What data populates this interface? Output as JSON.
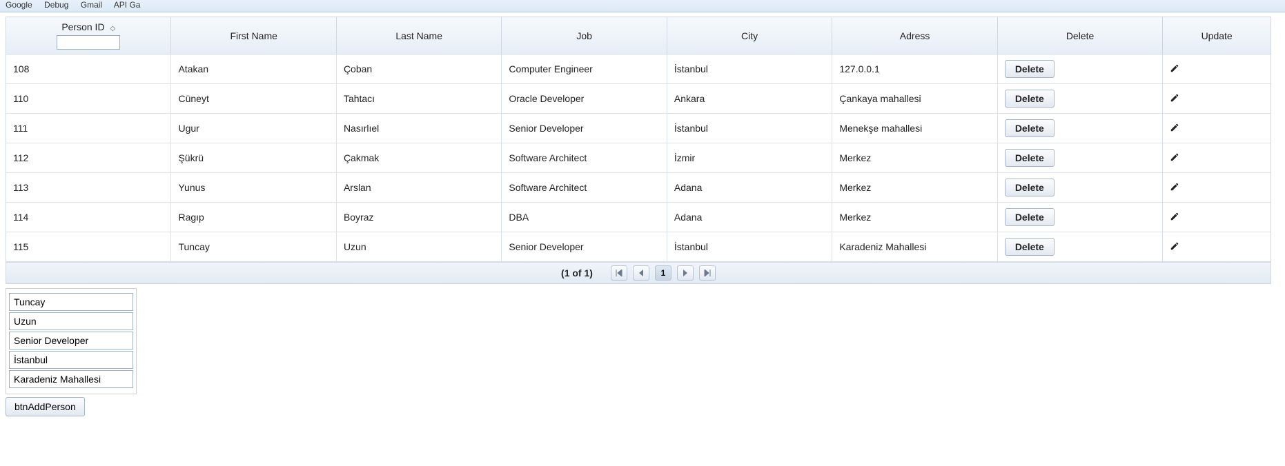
{
  "bookmarks": [
    "Google",
    "Debug",
    "Gmail",
    "API Ga"
  ],
  "table": {
    "headers": {
      "person_id": "Person ID",
      "first_name": "First Name",
      "last_name": "Last Name",
      "job": "Job",
      "city": "City",
      "address": "Adress",
      "delete": "Delete",
      "update": "Update"
    },
    "filter_person_id": "",
    "rows": [
      {
        "id": "108",
        "first": "Atakan",
        "last": "Çoban",
        "job": "Computer Engineer",
        "city": "İstanbul",
        "addr": "127.0.0.1",
        "del": "Delete"
      },
      {
        "id": "110",
        "first": "Cüneyt",
        "last": "Tahtacı",
        "job": "Oracle Developer",
        "city": "Ankara",
        "addr": "Çankaya mahallesi",
        "del": "Delete"
      },
      {
        "id": "111",
        "first": "Ugur",
        "last": "Nasırlıel",
        "job": "Senior Developer",
        "city": "İstanbul",
        "addr": "Menekşe mahallesi",
        "del": "Delete"
      },
      {
        "id": "112",
        "first": "Şükrü",
        "last": "Çakmak",
        "job": "Software Architect",
        "city": "İzmir",
        "addr": "Merkez",
        "del": "Delete"
      },
      {
        "id": "113",
        "first": "Yunus",
        "last": "Arslan",
        "job": "Software Architect",
        "city": "Adana",
        "addr": "Merkez",
        "del": "Delete"
      },
      {
        "id": "114",
        "first": "Ragıp",
        "last": "Boyraz",
        "job": "DBA",
        "city": "Adana",
        "addr": "Merkez",
        "del": "Delete"
      },
      {
        "id": "115",
        "first": "Tuncay",
        "last": "Uzun",
        "job": "Senior Developer",
        "city": "İstanbul",
        "addr": "Karadeniz Mahallesi",
        "del": "Delete"
      }
    ]
  },
  "paginator": {
    "status": "(1 of 1)",
    "current_page": "1"
  },
  "form": {
    "first": "Tuncay",
    "last": "Uzun",
    "job": "Senior Developer",
    "city": "İstanbul",
    "addr": "Karadeniz Mahallesi",
    "add_button": "btnAddPerson"
  }
}
